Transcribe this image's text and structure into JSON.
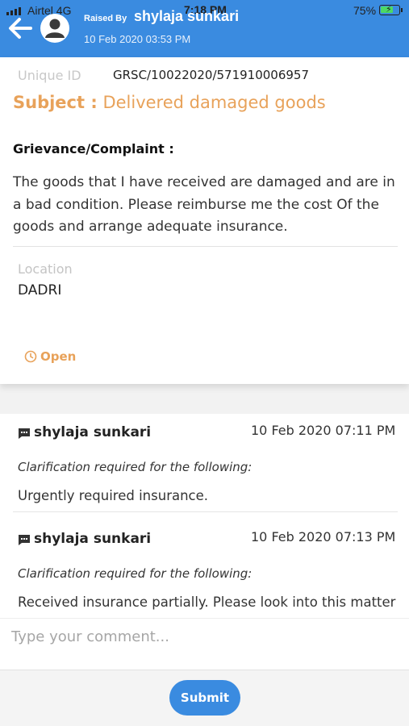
{
  "status_bar": {
    "carrier": "Airtel",
    "network": "4G",
    "time": "7:18 PM",
    "battery": "75%",
    "battery_level": 0.75
  },
  "header": {
    "raised_by_label": "Raised By",
    "raised_by_name": "shylaja sunkari",
    "date": "10 Feb 2020 03:53 PM",
    "background": "#3a8be0"
  },
  "grievance": {
    "unique_id_label": "Unique ID",
    "unique_id": "GRSC/10022020/571910006957",
    "subject_label": "Subject :",
    "subject": "Delivered damaged goods",
    "complaint_label": "Grievance/Complaint :",
    "complaint_text": "The goods that I have received are damaged and are in a bad condition. Please reimburse me the cost Of the goods and arrange adequate insurance.",
    "location_label": "Location",
    "location": "DADRI",
    "status": "Open",
    "accent": "#e8a25a"
  },
  "comments": [
    {
      "author": "shylaja sunkari",
      "date": "10 Feb 2020 07:11 PM",
      "clarification_label": "Clarification required for the following:",
      "text": "Urgently required insurance."
    },
    {
      "author": "shylaja sunkari",
      "date": "10 Feb 2020 07:13 PM",
      "clarification_label": "Clarification required for the following:",
      "text": "Received insurance partially. Please look into this matter"
    }
  ],
  "comment_input": {
    "placeholder": "Type your comment...",
    "value": ""
  },
  "submit_label": "Submit"
}
